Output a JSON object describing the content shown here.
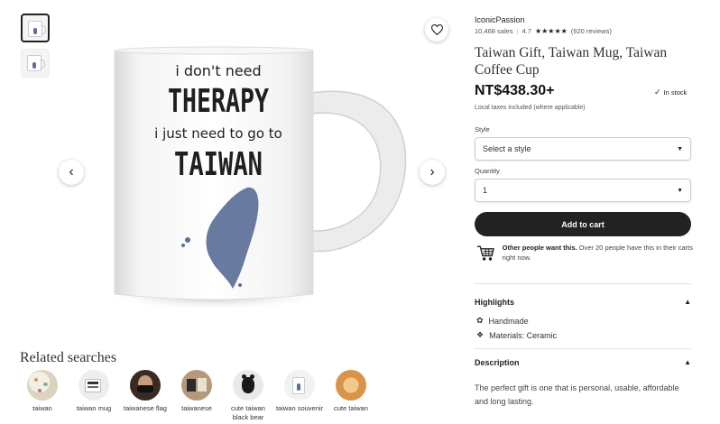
{
  "gallery": {
    "thumbnails": [
      {
        "name": "mug-front"
      },
      {
        "name": "mug-angle"
      }
    ],
    "mug": {
      "line1": "i don't need",
      "line2": "THERAPY",
      "line3": "i just need to go to",
      "line4": "TAIWAN"
    },
    "map_color": "#5c6f99"
  },
  "shop": {
    "name": "IconicPassion",
    "sales": "10,468 sales",
    "rating": "4.7",
    "stars": "★★★★★",
    "reviews": "(920 reviews)"
  },
  "product": {
    "title": "Taiwan Gift, Taiwan Mug, Taiwan Coffee Cup",
    "price": "NT$438.30+",
    "stock": "In stock",
    "tax_note": "Local taxes included (where applicable)"
  },
  "options": {
    "style_label": "Style",
    "style_value": "Select a style",
    "quantity_label": "Quantity",
    "quantity_value": "1"
  },
  "cart": {
    "button_label": "Add to cart",
    "demand_bold": "Other people want this.",
    "demand_rest": " Over 20 people have this in their carts right now."
  },
  "highlights": {
    "title": "Highlights",
    "items": [
      "Handmade",
      "Materials: Ceramic"
    ]
  },
  "description": {
    "title": "Description",
    "text": "The perfect gift is one that is personal, usable, affordable and long lasting."
  },
  "related": {
    "title": "Related searches",
    "items": [
      {
        "label": "taiwan"
      },
      {
        "label": "taiwan mug"
      },
      {
        "label": "taiwanese flag"
      },
      {
        "label": "taiwanese"
      },
      {
        "label": "cute taiwan black bear"
      },
      {
        "label": "taiwan souvenir"
      },
      {
        "label": "cute taiwan"
      }
    ]
  },
  "colors": {
    "primary_button": "#222222",
    "map_blue": "#5c6f99"
  }
}
